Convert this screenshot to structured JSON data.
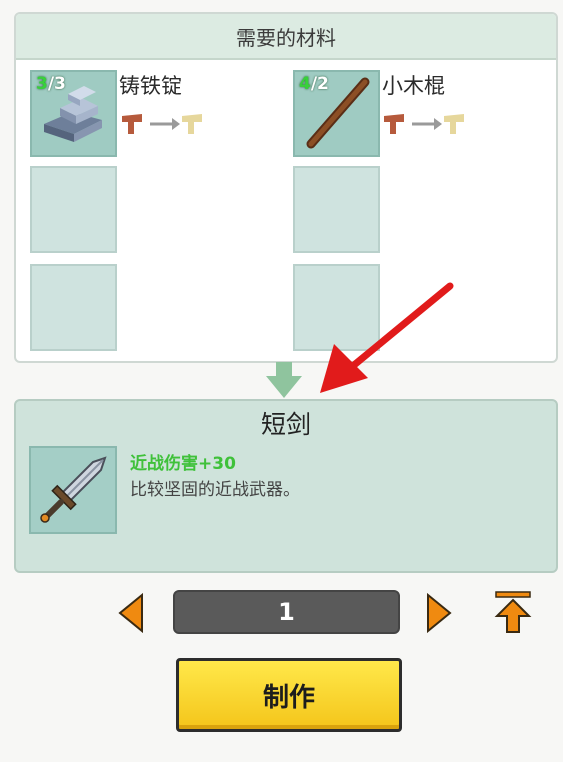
{
  "materials": {
    "header": "需要的材料",
    "items": [
      {
        "have": "3",
        "need": "/3",
        "name": "铸铁锭",
        "icon": "iron-ingot-icon"
      },
      {
        "have": "4",
        "need": "/2",
        "name": "小木棍",
        "icon": "wooden-stick-icon"
      }
    ]
  },
  "result": {
    "title": "短剑",
    "stat": "近战伤害+30",
    "description": "比较坚固的近战武器。",
    "icon": "short-sword-icon"
  },
  "quantity": {
    "value": "1"
  },
  "craft_button": {
    "label": "制作"
  },
  "colors": {
    "accent_orange": "#f08a10",
    "button_yellow": "#ffe84a",
    "stat_green": "#3fc13a",
    "annotation_red": "#e11b1b"
  }
}
